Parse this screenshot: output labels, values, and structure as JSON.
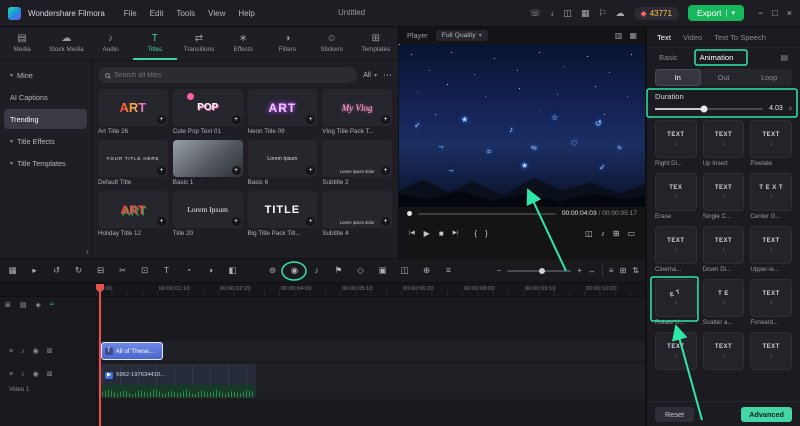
{
  "colors": {
    "accent": "#3ad6ab",
    "annotation": "#2ee8a8",
    "export_button": "#17b85c",
    "playhead": "#e8504b",
    "text_clip": "#5b76dd",
    "audio_waveform": "#2f8a52",
    "coin_count": "#ffc24b"
  },
  "glyphs": {
    "chevron_down": "▾",
    "more": "⋯",
    "collapse": "‹",
    "minimize": "−",
    "maximize": "□",
    "close": "×",
    "gem": "◆",
    "plus": "+",
    "download": "↓",
    "prev_frame": "|◀",
    "play": "▶",
    "stop": "■",
    "next_frame": "▶|",
    "mark_in": "{",
    "mark_out": "}",
    "snapshot": "◫",
    "volume": "♪",
    "fullscreen": "⊞",
    "aspect_ratio": "▭",
    "display_settings": "▥",
    "display_grid": "▦",
    "library": "▤",
    "zoom_out": "−",
    "zoom_in": "+",
    "fit": "↔",
    "list_view": "≡",
    "grid_view": "⊞",
    "track_updown": "⇅",
    "mute": "♪",
    "visibility": "◉",
    "lock": "⊠",
    "track_menu": "≡",
    "text_badge": "T",
    "video_badge": "▶",
    "add_track": "⊞",
    "track_manager": "▤",
    "magnet": "◈",
    "auto_ripple": "≈"
  },
  "titlebar": {
    "app_name": "Wondershare Filmora",
    "menus": [
      "File",
      "Edit",
      "Tools",
      "View",
      "Help"
    ],
    "project_name": "Untitled",
    "icons": [
      {
        "name": "contact",
        "glyph": "☏"
      },
      {
        "name": "download",
        "glyph": "↓"
      },
      {
        "name": "screen-record",
        "glyph": "◫"
      },
      {
        "name": "layout",
        "glyph": "▦"
      },
      {
        "name": "notification",
        "glyph": "⚐"
      },
      {
        "name": "resources",
        "glyph": "☁"
      }
    ],
    "coins": "43771",
    "export_label": "Export"
  },
  "media_tabs": [
    {
      "label": "Media",
      "icon": "▤"
    },
    {
      "label": "Stock Media",
      "icon": "☁"
    },
    {
      "label": "Audio",
      "icon": "♪"
    },
    {
      "label": "Titles",
      "icon": "T"
    },
    {
      "label": "Transitions",
      "icon": "⇄"
    },
    {
      "label": "Effects",
      "icon": "∗"
    },
    {
      "label": "Filters",
      "icon": "◑"
    },
    {
      "label": "Stickers",
      "icon": "☺"
    },
    {
      "label": "Templates",
      "icon": "⊞"
    }
  ],
  "sidebar": {
    "items": [
      {
        "label": "Mine"
      },
      {
        "label": "AI Captions"
      },
      {
        "label": "Trending"
      },
      {
        "label": "Title Effects"
      },
      {
        "label": "Title Templates"
      }
    ]
  },
  "search": {
    "placeholder": "Search all titles",
    "filter_label": "All"
  },
  "titles": [
    {
      "name": "Art Title 26",
      "tile": "ART"
    },
    {
      "name": "Cute Pop Text 01",
      "tile": "POP"
    },
    {
      "name": "Neon Title 09",
      "tile": "ART"
    },
    {
      "name": "Vlog Title Pack T...",
      "tile": "My Vlog"
    },
    {
      "name": "Default Title",
      "tile": "YOUR TITLE HERE"
    },
    {
      "name": "Basic 1",
      "tile": ""
    },
    {
      "name": "Basic 6",
      "tile": "Lorem Ipsum"
    },
    {
      "name": "Subtitle 2",
      "tile": "Lorem ipsum dolor"
    },
    {
      "name": "Holiday Title 12",
      "tile": "ART"
    },
    {
      "name": "Title 20",
      "tile": "Lorem Ipsum"
    },
    {
      "name": "Big Title Pack Titl...",
      "tile": "TITLE"
    },
    {
      "name": "Subtitle 4",
      "tile": "Lorem ipsum dolor"
    }
  ],
  "player": {
    "label": "Player",
    "quality": "Full Quality",
    "current": "00:00:04:03",
    "separator": " / ",
    "total": "00:00:05:17"
  },
  "preview": {
    "doodles": [
      "✓",
      "→",
      "★",
      "≈",
      "♪",
      "∞",
      "☆",
      "♡",
      "↺",
      "≈",
      "→",
      "★",
      "✓"
    ]
  },
  "inspector": {
    "tabs": [
      {
        "label": "Text"
      },
      {
        "label": "Video"
      },
      {
        "label": "Text To Speech"
      }
    ],
    "subtabs": [
      {
        "label": "Basic"
      },
      {
        "label": "Animation"
      }
    ],
    "anim_tabs": [
      {
        "label": "In"
      },
      {
        "label": "Out"
      },
      {
        "label": "Loop"
      }
    ],
    "duration": {
      "label": "Duration",
      "value": "4.03",
      "unit": "s"
    },
    "presets": [
      {
        "label": "Right Di...",
        "tile": "TEXT"
      },
      {
        "label": "Up Insert",
        "tile": "TEXT"
      },
      {
        "label": "Pixelate",
        "tile": "TEXT"
      },
      {
        "label": "Erase",
        "tile": "TEX"
      },
      {
        "label": "Single C...",
        "tile": "TEXT"
      },
      {
        "label": "Center G...",
        "tile": "T E X T"
      },
      {
        "label": "Cinema...",
        "tile": "TEXT"
      },
      {
        "label": "Down Di...",
        "tile": "TEXT"
      },
      {
        "label": "Upper-le...",
        "tile": "TEXT"
      },
      {
        "label": "Rotate U...",
        "tile": "E T"
      },
      {
        "label": "Scatter a...",
        "tile": "T E"
      },
      {
        "label": "Forward...",
        "tile": "TEXT"
      },
      {
        "label": "",
        "tile": "TEXT"
      },
      {
        "label": "",
        "tile": "TEXT"
      },
      {
        "label": "",
        "tile": "TEXT"
      }
    ],
    "reset_label": "Reset",
    "advanced_label": "Advanced"
  },
  "timeline": {
    "toolbar": [
      {
        "name": "toolbox",
        "glyph": "▦"
      },
      {
        "name": "select",
        "glyph": "▸"
      },
      {
        "name": "undo",
        "glyph": "↺"
      },
      {
        "name": "redo",
        "glyph": "↻"
      },
      {
        "name": "delete",
        "glyph": "⊟"
      },
      {
        "name": "split",
        "glyph": "✂"
      },
      {
        "name": "crop",
        "glyph": "⊡"
      },
      {
        "name": "quick-text",
        "glyph": "T"
      },
      {
        "name": "speed",
        "glyph": "◔"
      },
      {
        "name": "color",
        "glyph": "◑"
      },
      {
        "name": "mask",
        "glyph": "◧"
      },
      {
        "name": "render-preview",
        "glyph": "⊚"
      },
      {
        "name": "record",
        "glyph": "◉"
      },
      {
        "name": "voiceover",
        "glyph": "♪"
      },
      {
        "name": "marker",
        "glyph": "⚑"
      },
      {
        "name": "keyframe",
        "glyph": "◇"
      },
      {
        "name": "chroma-key",
        "glyph": "▣"
      },
      {
        "name": "pip",
        "glyph": "◫"
      },
      {
        "name": "motion-track",
        "glyph": "⊕"
      },
      {
        "name": "audio-mixer",
        "glyph": "≡"
      }
    ],
    "ruler": [
      "00:00",
      "00:00:01:10",
      "00:00:02:20",
      "00:00:04:00",
      "00:00:05:10",
      "00:00:06:20",
      "00:00:08:00",
      "00:00:09:10",
      "00:00:10:20"
    ],
    "text_clip": "All of These...",
    "video_clip": "6962-197634410...",
    "video_track_label": "Video 1"
  }
}
